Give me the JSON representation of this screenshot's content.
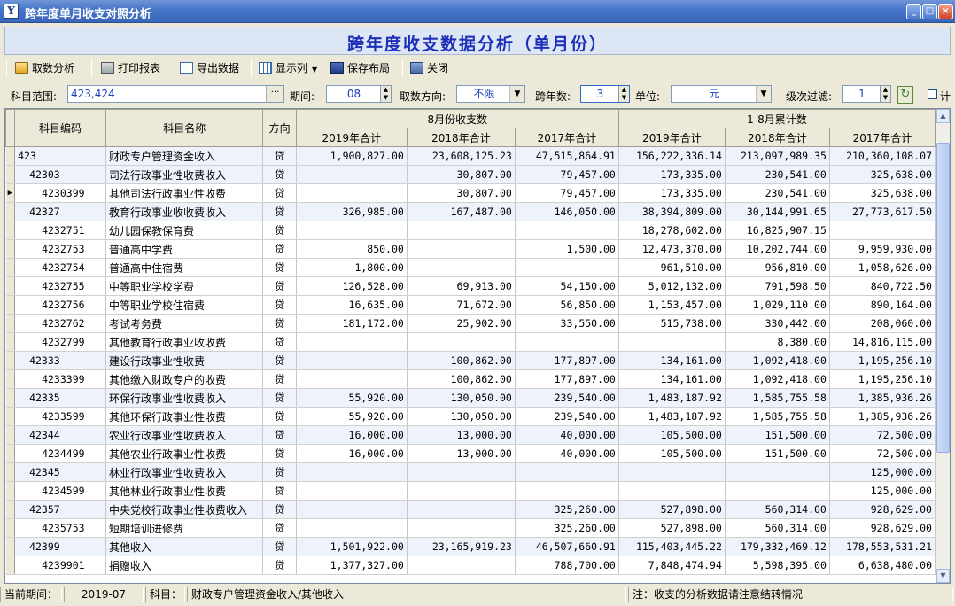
{
  "window": {
    "app_icon": "Y",
    "title": "跨年度单月收支对照分析"
  },
  "banner": {
    "title": "跨年度收支数据分析（单月份）"
  },
  "toolbar": {
    "fetch": "取数分析",
    "print": "打印报表",
    "export": "导出数据",
    "columns": "显示列",
    "save_layout": "保存布局",
    "close": "关闭"
  },
  "filters": {
    "subject_range_label": "科目范围:",
    "subject_range_value": "423,424",
    "period_label": "期间:",
    "period_value": "08",
    "direction_label": "取数方向:",
    "direction_value": "不限",
    "cross_years_label": "跨年数:",
    "cross_years_value": "3",
    "unit_label": "单位:",
    "unit_value": "元",
    "level_label": "级次过滤:",
    "level_value": "1",
    "extra_checkbox_label": "计"
  },
  "table": {
    "headers": {
      "code": "科目编码",
      "name": "科目名称",
      "dir": "方向",
      "group_month": "8月份收支数",
      "group_cum": "1-8月累计数",
      "y2019": "2019年合计",
      "y2018": "2018年合计",
      "y2017": "2017年合计"
    },
    "rows": [
      {
        "code": "423",
        "name": "财政专户管理资金收入",
        "dir": "贷",
        "m19": "1,900,827.00",
        "m18": "23,608,125.23",
        "m17": "47,515,864.91",
        "c19": "156,222,336.14",
        "c18": "213,097,989.35",
        "c17": "210,360,108.07",
        "hl": true,
        "indent": 0
      },
      {
        "code": "42303",
        "name": "司法行政事业性收费收入",
        "dir": "贷",
        "m19": "",
        "m18": "30,807.00",
        "m17": "79,457.00",
        "c19": "173,335.00",
        "c18": "230,541.00",
        "c17": "325,638.00",
        "hl": true,
        "indent": 1
      },
      {
        "code": "4230399",
        "name": "其他司法行政事业性收费",
        "dir": "贷",
        "m19": "",
        "m18": "30,807.00",
        "m17": "79,457.00",
        "c19": "173,335.00",
        "c18": "230,541.00",
        "c17": "325,638.00",
        "hl": false,
        "indent": 2,
        "current": true
      },
      {
        "code": "42327",
        "name": "教育行政事业收收费收入",
        "dir": "贷",
        "m19": "326,985.00",
        "m18": "167,487.00",
        "m17": "146,050.00",
        "c19": "38,394,809.00",
        "c18": "30,144,991.65",
        "c17": "27,773,617.50",
        "hl": true,
        "indent": 1
      },
      {
        "code": "4232751",
        "name": "幼儿园保教保育费",
        "dir": "贷",
        "m19": "",
        "m18": "",
        "m17": "",
        "c19": "18,278,602.00",
        "c18": "16,825,907.15",
        "c17": "",
        "hl": false,
        "indent": 2
      },
      {
        "code": "4232753",
        "name": "普通高中学费",
        "dir": "贷",
        "m19": "850.00",
        "m18": "",
        "m17": "1,500.00",
        "c19": "12,473,370.00",
        "c18": "10,202,744.00",
        "c17": "9,959,930.00",
        "hl": false,
        "indent": 2
      },
      {
        "code": "4232754",
        "name": "普通高中住宿费",
        "dir": "贷",
        "m19": "1,800.00",
        "m18": "",
        "m17": "",
        "c19": "961,510.00",
        "c18": "956,810.00",
        "c17": "1,058,626.00",
        "hl": false,
        "indent": 2
      },
      {
        "code": "4232755",
        "name": "中等职业学校学费",
        "dir": "贷",
        "m19": "126,528.00",
        "m18": "69,913.00",
        "m17": "54,150.00",
        "c19": "5,012,132.00",
        "c18": "791,598.50",
        "c17": "840,722.50",
        "hl": false,
        "indent": 2
      },
      {
        "code": "4232756",
        "name": "中等职业学校住宿费",
        "dir": "贷",
        "m19": "16,635.00",
        "m18": "71,672.00",
        "m17": "56,850.00",
        "c19": "1,153,457.00",
        "c18": "1,029,110.00",
        "c17": "890,164.00",
        "hl": false,
        "indent": 2
      },
      {
        "code": "4232762",
        "name": "考试考务费",
        "dir": "贷",
        "m19": "181,172.00",
        "m18": "25,902.00",
        "m17": "33,550.00",
        "c19": "515,738.00",
        "c18": "330,442.00",
        "c17": "208,060.00",
        "hl": false,
        "indent": 2
      },
      {
        "code": "4232799",
        "name": "其他教育行政事业收收费",
        "dir": "贷",
        "m19": "",
        "m18": "",
        "m17": "",
        "c19": "",
        "c18": "8,380.00",
        "c17": "14,816,115.00",
        "hl": false,
        "indent": 2
      },
      {
        "code": "42333",
        "name": "建设行政事业性收费",
        "dir": "贷",
        "m19": "",
        "m18": "100,862.00",
        "m17": "177,897.00",
        "c19": "134,161.00",
        "c18": "1,092,418.00",
        "c17": "1,195,256.10",
        "hl": true,
        "indent": 1
      },
      {
        "code": "4233399",
        "name": "其他缴入财政专户的收费",
        "dir": "贷",
        "m19": "",
        "m18": "100,862.00",
        "m17": "177,897.00",
        "c19": "134,161.00",
        "c18": "1,092,418.00",
        "c17": "1,195,256.10",
        "hl": false,
        "indent": 2
      },
      {
        "code": "42335",
        "name": "环保行政事业性收费收入",
        "dir": "贷",
        "m19": "55,920.00",
        "m18": "130,050.00",
        "m17": "239,540.00",
        "c19": "1,483,187.92",
        "c18": "1,585,755.58",
        "c17": "1,385,936.26",
        "hl": true,
        "indent": 1
      },
      {
        "code": "4233599",
        "name": "其他环保行政事业性收费",
        "dir": "贷",
        "m19": "55,920.00",
        "m18": "130,050.00",
        "m17": "239,540.00",
        "c19": "1,483,187.92",
        "c18": "1,585,755.58",
        "c17": "1,385,936.26",
        "hl": false,
        "indent": 2
      },
      {
        "code": "42344",
        "name": "农业行政事业性收费收入",
        "dir": "贷",
        "m19": "16,000.00",
        "m18": "13,000.00",
        "m17": "40,000.00",
        "c19": "105,500.00",
        "c18": "151,500.00",
        "c17": "72,500.00",
        "hl": true,
        "indent": 1
      },
      {
        "code": "4234499",
        "name": "其他农业行政事业性收费",
        "dir": "贷",
        "m19": "16,000.00",
        "m18": "13,000.00",
        "m17": "40,000.00",
        "c19": "105,500.00",
        "c18": "151,500.00",
        "c17": "72,500.00",
        "hl": false,
        "indent": 2
      },
      {
        "code": "42345",
        "name": "林业行政事业性收费收入",
        "dir": "贷",
        "m19": "",
        "m18": "",
        "m17": "",
        "c19": "",
        "c18": "",
        "c17": "125,000.00",
        "hl": true,
        "indent": 1
      },
      {
        "code": "4234599",
        "name": "其他林业行政事业性收费",
        "dir": "贷",
        "m19": "",
        "m18": "",
        "m17": "",
        "c19": "",
        "c18": "",
        "c17": "125,000.00",
        "hl": false,
        "indent": 2
      },
      {
        "code": "42357",
        "name": "中央党校行政事业性收费收入",
        "dir": "贷",
        "m19": "",
        "m18": "",
        "m17": "325,260.00",
        "c19": "527,898.00",
        "c18": "560,314.00",
        "c17": "928,629.00",
        "hl": true,
        "indent": 1
      },
      {
        "code": "4235753",
        "name": "短期培训进修费",
        "dir": "贷",
        "m19": "",
        "m18": "",
        "m17": "325,260.00",
        "c19": "527,898.00",
        "c18": "560,314.00",
        "c17": "928,629.00",
        "hl": false,
        "indent": 2
      },
      {
        "code": "42399",
        "name": "其他收入",
        "dir": "贷",
        "m19": "1,501,922.00",
        "m18": "23,165,919.23",
        "m17": "46,507,660.91",
        "c19": "115,403,445.22",
        "c18": "179,332,469.12",
        "c17": "178,553,531.21",
        "hl": true,
        "indent": 1
      },
      {
        "code": "4239901",
        "name": "捐赠收入",
        "dir": "贷",
        "m19": "1,377,327.00",
        "m18": "",
        "m17": "788,700.00",
        "c19": "7,848,474.94",
        "c18": "5,598,395.00",
        "c17": "6,638,480.00",
        "hl": false,
        "indent": 2
      }
    ]
  },
  "status": {
    "period_label": "当前期间：",
    "period_value": "2019-07",
    "subject_label": "科目：",
    "subject_value": "财政专户管理资金收入/其他收入",
    "note": "注：收支的分析数据请注意结转情况"
  },
  "icons": {
    "fetch": "folder-open-icon",
    "print": "printer-icon",
    "export": "export-icon",
    "columns": "columns-grid-icon",
    "save_layout": "floppy-icon",
    "close": "exit-icon",
    "refresh": "refresh-icon",
    "row_pointer": "row-pointer-icon"
  },
  "colors": {
    "title_blue": "#1c2fb8",
    "titlebar": "#3a67b8",
    "group_row": "#eef2fb",
    "value_blue": "#1a3fbf"
  }
}
